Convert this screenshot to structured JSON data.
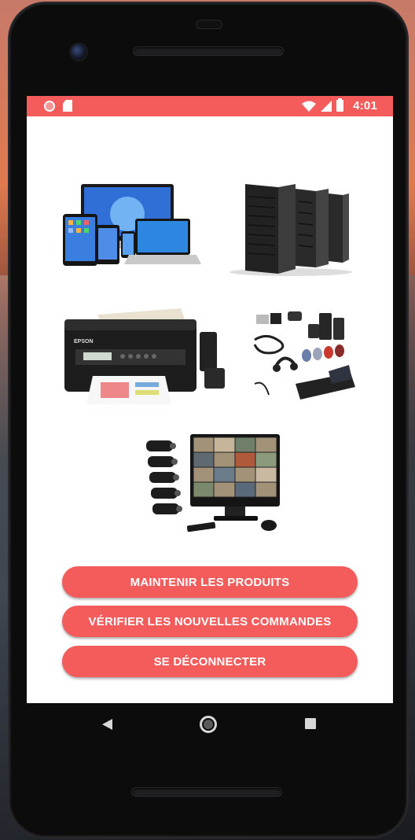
{
  "status_bar": {
    "time": "4:01",
    "bg_color": "#f45b5b",
    "left_icons": [
      "notification-dot-icon",
      "sd-card-icon"
    ],
    "right_icons": [
      "wifi-icon",
      "signal-icon",
      "battery-charging-icon"
    ]
  },
  "images": [
    {
      "name": "devices-image",
      "label": "tablets, smartphones and laptops"
    },
    {
      "name": "servers-image",
      "label": "server racks"
    },
    {
      "name": "printer-image",
      "label": "EPSON printer"
    },
    {
      "name": "accessories-image",
      "label": "computer accessories"
    },
    {
      "name": "surveillance-image",
      "label": "CCTV cameras and monitor"
    }
  ],
  "printer_brand": "EPSON",
  "buttons": {
    "maintain": "MAINTENIR LES PRODUITS",
    "new_orders": "VÉRIFIER LES NOUVELLES COMMANDES",
    "logout": "SE DÉCONNECTER"
  },
  "accent_color": "#f45b5b",
  "nav_bar": {
    "icons": [
      "back-icon",
      "home-icon",
      "recent-apps-icon"
    ]
  }
}
